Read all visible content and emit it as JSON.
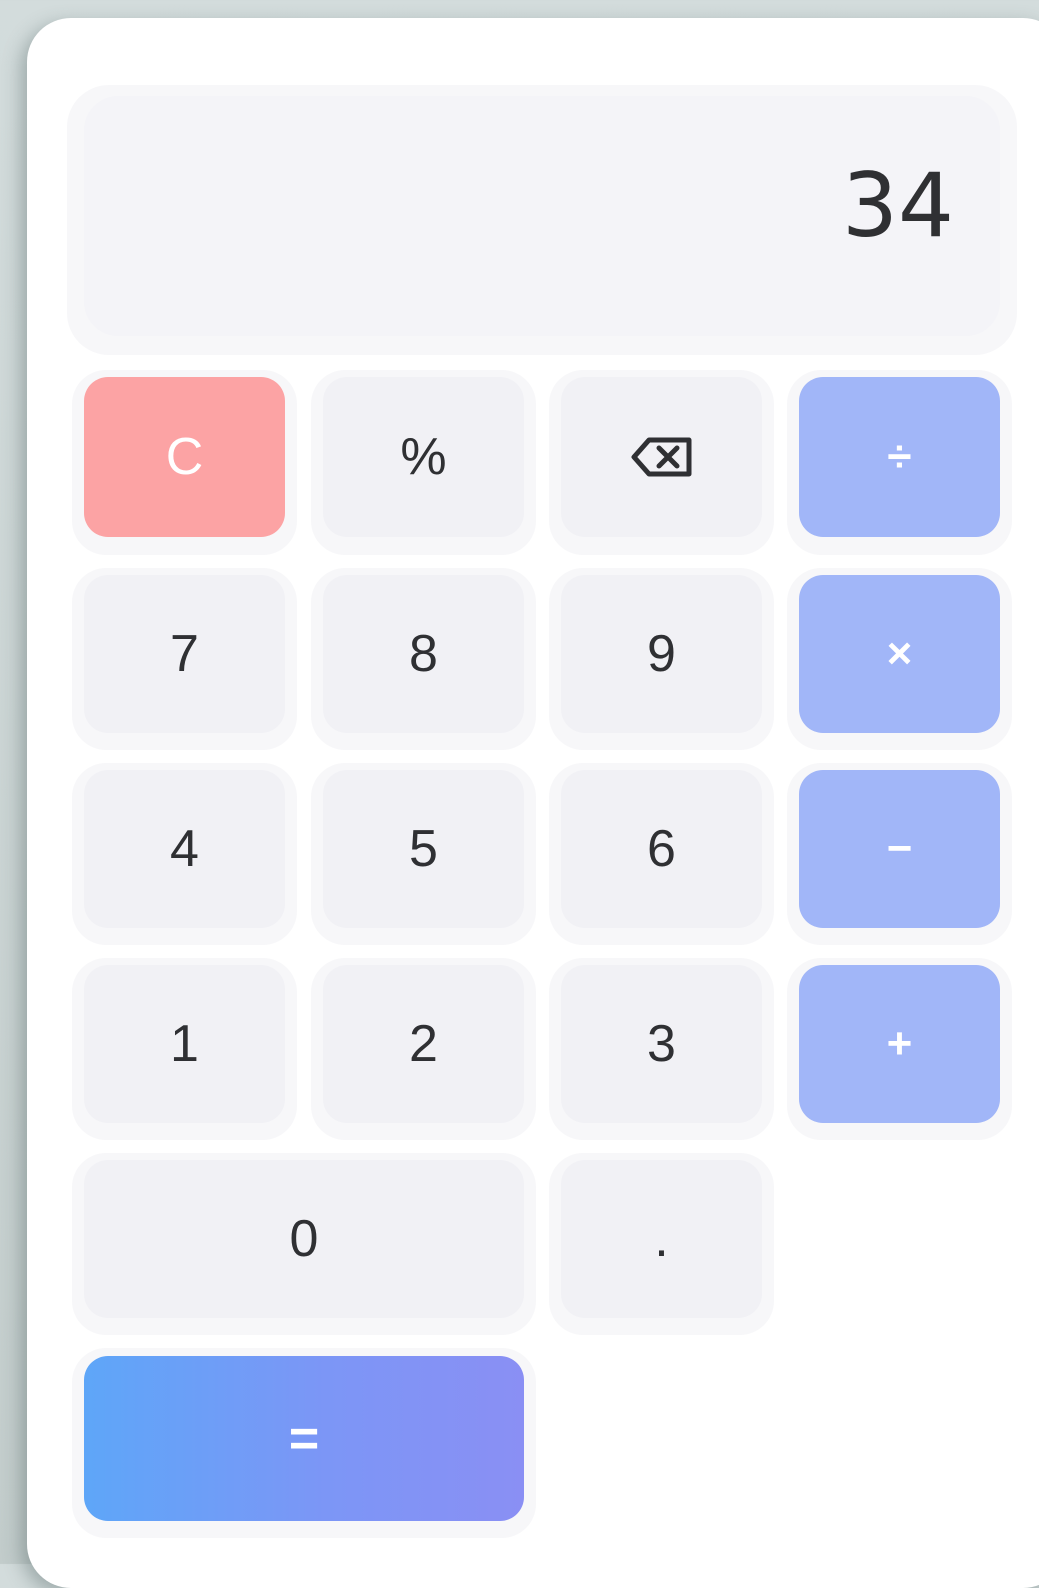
{
  "display": {
    "value": "34"
  },
  "keys": {
    "clear": "C",
    "percent": "%",
    "backspace_icon": "backspace-icon",
    "divide": "÷",
    "seven": "7",
    "eight": "8",
    "nine": "9",
    "multiply": "×",
    "four": "4",
    "five": "5",
    "six": "6",
    "subtract": "−",
    "one": "1",
    "two": "2",
    "three": "3",
    "add": "+",
    "zero": "0",
    "decimal": ".",
    "equals": "="
  },
  "colors": {
    "clear_key": "#fca3a4",
    "operator_key": "#a1b6f8",
    "number_key": "#f1f1f5",
    "equals_gradient_start": "#5ea6f8",
    "equals_gradient_end": "#8a8ff4",
    "display_text": "#2f3033"
  }
}
